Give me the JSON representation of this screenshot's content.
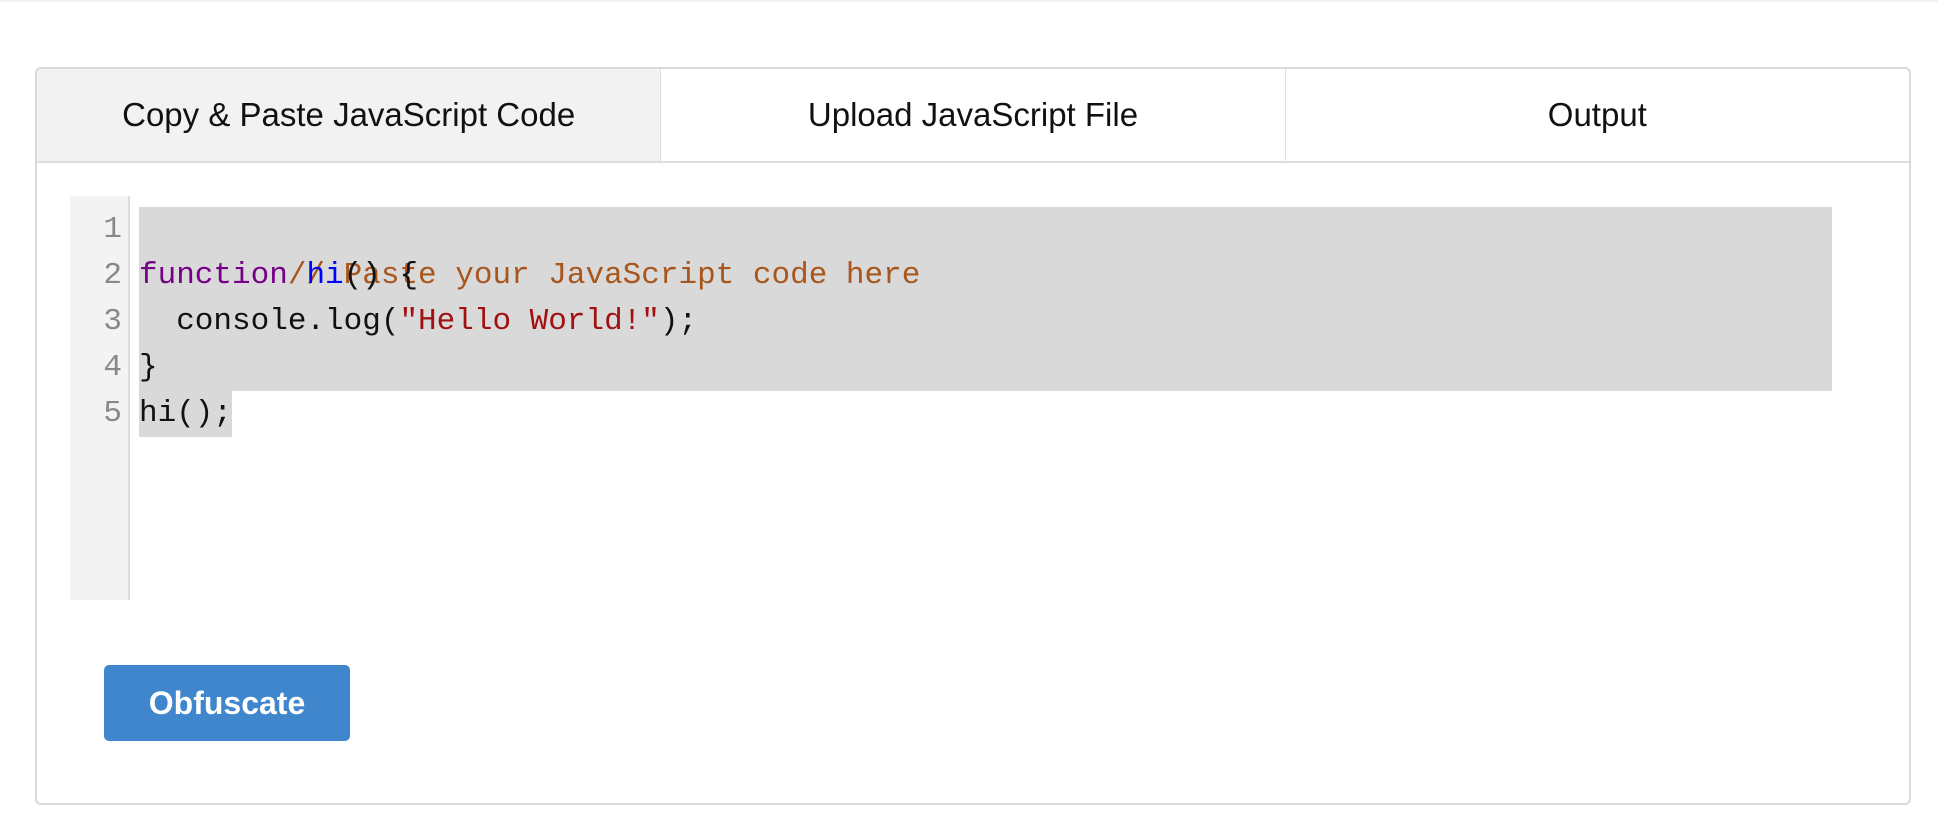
{
  "tabs": [
    {
      "label": "Copy & Paste JavaScript Code",
      "active": true
    },
    {
      "label": "Upload JavaScript File",
      "active": false
    },
    {
      "label": "Output",
      "active": false
    }
  ],
  "editor": {
    "line_numbers": [
      "1",
      "2",
      "3",
      "4",
      "5"
    ],
    "lines": [
      [
        {
          "t": "// Paste your JavaScript code here",
          "c": "comment"
        }
      ],
      [
        {
          "t": "function",
          "c": "keyword"
        },
        {
          "t": " ",
          "c": ""
        },
        {
          "t": "hi",
          "c": "def"
        },
        {
          "t": "() {",
          "c": ""
        }
      ],
      [
        {
          "t": "  console.log(",
          "c": ""
        },
        {
          "t": "\"Hello World!\"",
          "c": "string"
        },
        {
          "t": ");",
          "c": ""
        }
      ],
      [
        {
          "t": "}",
          "c": ""
        }
      ],
      [
        {
          "t": "hi();",
          "c": ""
        }
      ]
    ]
  },
  "obfuscate_button": {
    "label": "Obfuscate"
  },
  "colors": {
    "accent": "#3f86cd",
    "comment": "#a8561b",
    "keyword": "#770088",
    "def": "#0000ff",
    "string": "#a11111",
    "selection": "#d9d9d9"
  }
}
